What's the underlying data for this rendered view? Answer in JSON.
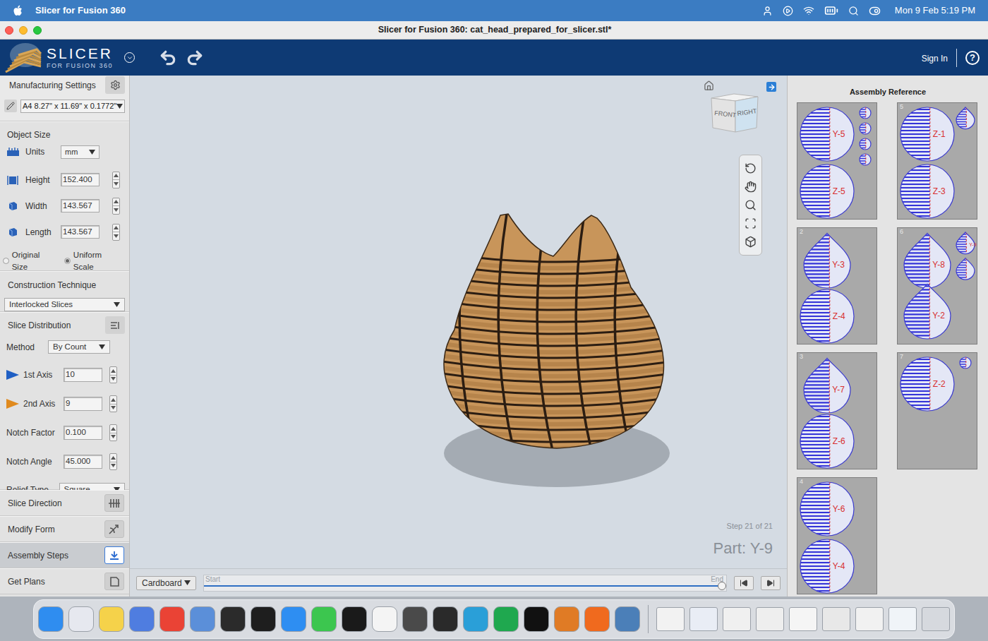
{
  "menubar": {
    "app": "Slicer for Fusion 360",
    "clock": "Mon 9 Feb 5:19 PM"
  },
  "window": {
    "title": "Slicer for Fusion 360: cat_head_prepared_for_slicer.stl*"
  },
  "header": {
    "logo_title": "SLICER",
    "logo_subtitle": "FOR FUSION 360",
    "sign_in": "Sign In",
    "help": "?"
  },
  "left_panel": {
    "manufacturing": {
      "label": "Manufacturing Settings",
      "sheet": "A4 8.27\" x 11.69\" x 0.1772\""
    },
    "object_size": {
      "label": "Object Size",
      "units_label": "Units",
      "units": "mm",
      "fields": [
        {
          "label": "Height",
          "value": "152.400"
        },
        {
          "label": "Width",
          "value": "143.567"
        },
        {
          "label": "Length",
          "value": "143.567"
        }
      ],
      "scale_options": [
        {
          "label": "Original Size",
          "selected": false
        },
        {
          "label": "Uniform Scale",
          "selected": true
        }
      ]
    },
    "construction": {
      "label": "Construction Technique",
      "value": "Interlocked Slices"
    },
    "slice_distribution": {
      "label": "Slice Distribution",
      "fields": [
        {
          "label": "Method",
          "value": "By Count",
          "kind": "select"
        },
        {
          "label": "1st Axis",
          "value": "10",
          "kind": "spinner",
          "color": "#1f5fc4"
        },
        {
          "label": "2nd Axis",
          "value": "9",
          "kind": "spinner",
          "color": "#e08a1e"
        },
        {
          "label": "Notch Factor",
          "value": "0.100",
          "kind": "spinner"
        },
        {
          "label": "Notch Angle",
          "value": "45.000",
          "kind": "spinner"
        },
        {
          "label": "Relief Type",
          "value": "Square",
          "kind": "select"
        }
      ]
    },
    "sections": [
      {
        "label": "Slice Direction",
        "selected": false
      },
      {
        "label": "Modify Form",
        "selected": false
      },
      {
        "label": "Assembly Steps",
        "selected": true
      },
      {
        "label": "Get Plans",
        "selected": false
      }
    ]
  },
  "viewport": {
    "view_cube": {
      "front": "FRONT",
      "right": "RIGHT"
    },
    "step": "Step 21 of 21",
    "part": "Part: Y-9",
    "material": "Cardboard",
    "timeline": {
      "start": "Start",
      "end": "End",
      "level": 1
    }
  },
  "assembly_reference": {
    "title": "Assembly Reference",
    "cards": [
      {
        "pieces": [
          {
            "kind": "circle",
            "label": "Y-5"
          },
          {
            "kind": "circle",
            "label": "Z-5"
          },
          {
            "kind": "small-circle"
          },
          {
            "kind": "small-circle"
          },
          {
            "kind": "small-circle"
          },
          {
            "kind": "small-circle"
          }
        ]
      },
      {
        "number": "5",
        "pieces": [
          {
            "kind": "circle",
            "label": "Z-1"
          },
          {
            "kind": "circle",
            "label": "Z-3"
          },
          {
            "kind": "small-drop"
          }
        ]
      },
      {
        "number": "2",
        "pieces": [
          {
            "kind": "drop",
            "label": "Y-3"
          },
          {
            "kind": "circle",
            "label": "Z-4"
          }
        ]
      },
      {
        "number": "6",
        "pieces": [
          {
            "kind": "drop",
            "label": "Y-8"
          },
          {
            "kind": "drop",
            "label": "Y-2"
          },
          {
            "kind": "small-drop",
            "label": "Y-9"
          },
          {
            "kind": "small-drop"
          }
        ]
      },
      {
        "number": "3",
        "pieces": [
          {
            "kind": "drop",
            "label": "Y-7"
          },
          {
            "kind": "circle",
            "label": "Z-6"
          }
        ]
      },
      {
        "number": "7",
        "pieces": [
          {
            "kind": "circle",
            "label": "Z-2"
          },
          {
            "kind": "small-circle"
          }
        ]
      },
      {
        "number": "4",
        "pieces": [
          {
            "kind": "circle",
            "label": "Y-6"
          },
          {
            "kind": "circle",
            "label": "Y-4"
          }
        ]
      }
    ]
  },
  "dock": {
    "apps": [
      {
        "color": "#2f8df0"
      },
      {
        "color": "#e6e8ef"
      },
      {
        "color": "#f5d24a"
      },
      {
        "color": "#4f7de0"
      },
      {
        "color": "#ea4335"
      },
      {
        "color": "#5b8fd9"
      },
      {
        "color": "#2b2b2b"
      },
      {
        "color": "#1e1e1e"
      },
      {
        "color": "#2e8ef2"
      },
      {
        "color": "#3cc64f"
      },
      {
        "color": "#1a1a1a"
      },
      {
        "color": "#f4f4f4"
      },
      {
        "color": "#4a4a4a"
      },
      {
        "color": "#2a2a2a"
      },
      {
        "color": "#2a9fd8"
      },
      {
        "color": "#1fa84f"
      },
      {
        "color": "#111111"
      },
      {
        "color": "#e07b25"
      },
      {
        "color": "#f06a1e"
      },
      {
        "color": "#4b7fb8"
      }
    ],
    "recent": [
      {
        "color": "#f2f2f2"
      },
      {
        "color": "#e9edf5"
      },
      {
        "color": "#f0f0f0"
      },
      {
        "color": "#eeeeee"
      },
      {
        "color": "#f5f5f5"
      },
      {
        "color": "#e8e8e8"
      },
      {
        "color": "#f1f1f1"
      },
      {
        "color": "#f0f4f8"
      },
      {
        "color": "#d6d9de"
      }
    ]
  }
}
